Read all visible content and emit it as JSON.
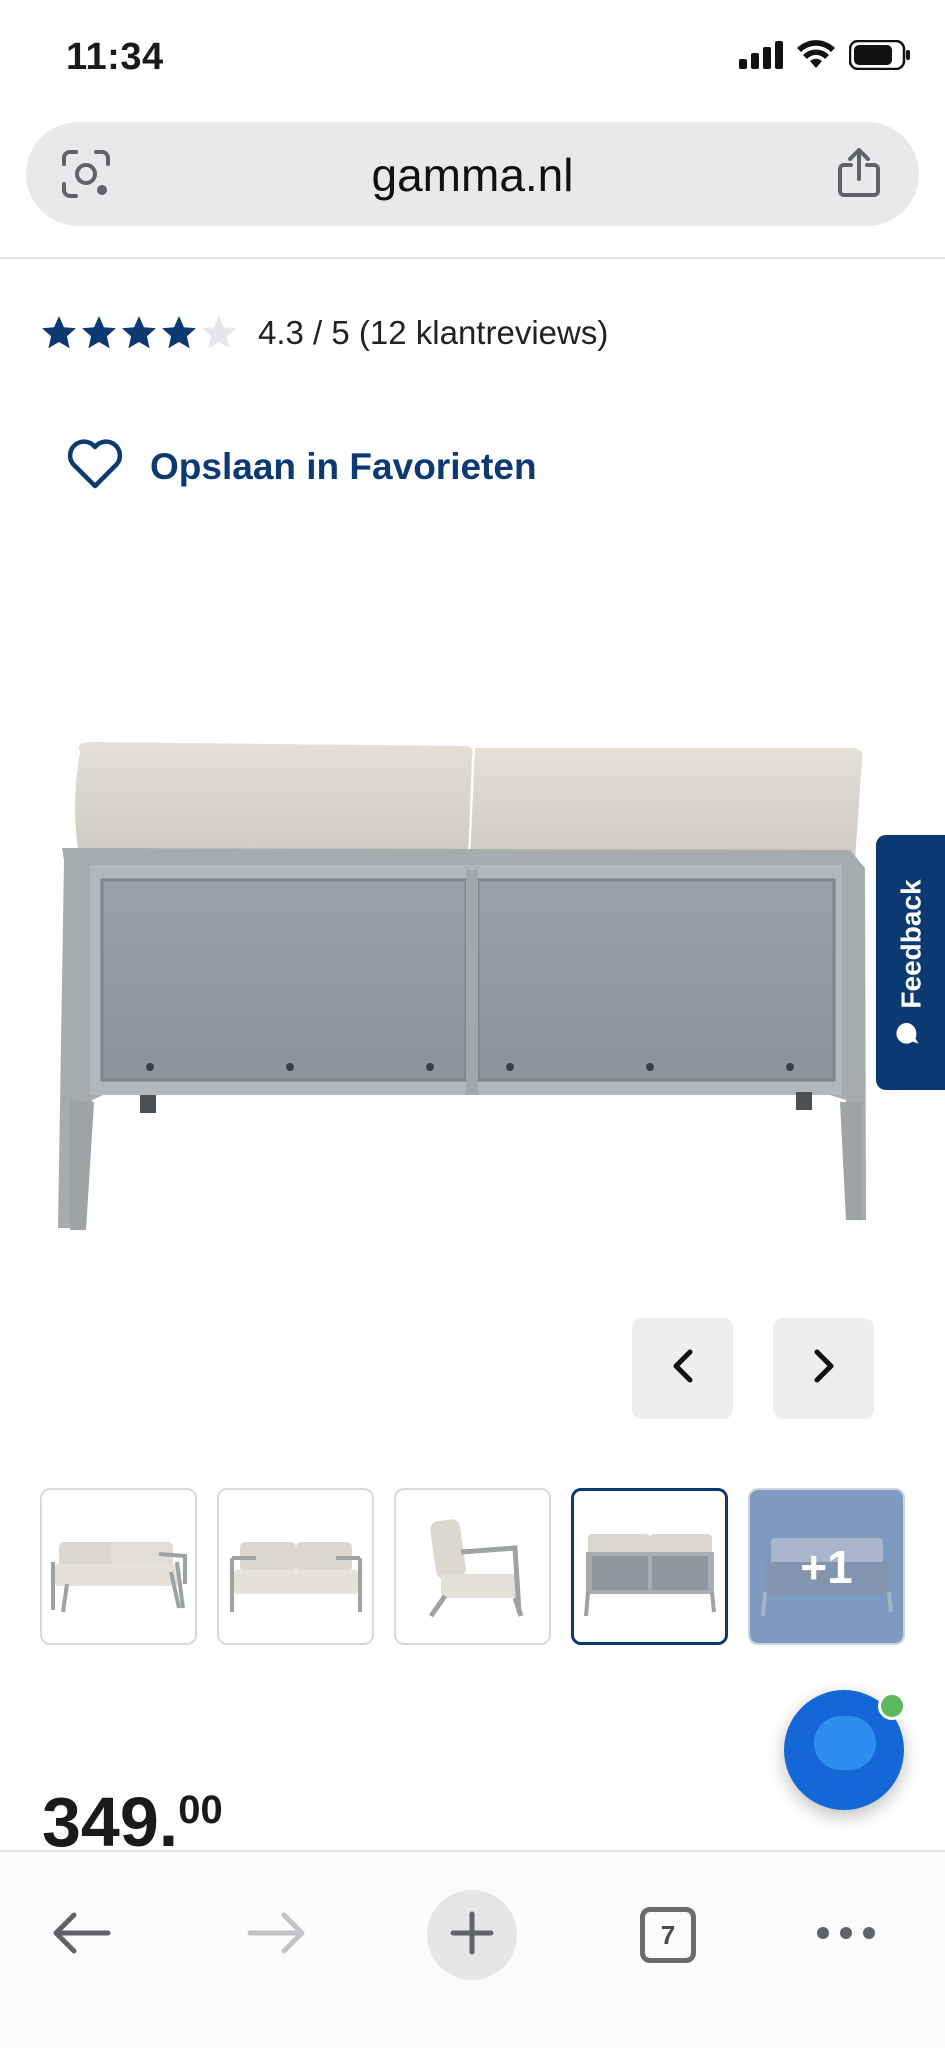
{
  "status_bar": {
    "time": "11:34",
    "icons": [
      "signal-icon",
      "wifi-icon",
      "battery-icon"
    ]
  },
  "browser": {
    "url": "gamma.nl",
    "lens_icon": "lens-icon",
    "share_icon": "share-icon"
  },
  "product": {
    "rating": {
      "stars_filled": 4,
      "stars_total": 5,
      "text": "4.3 / 5 (12 klantreviews)"
    },
    "favorite_label": "Opslaan in Favorieten",
    "image_alt_icon": "product-image",
    "gallery": {
      "thumbnails": [
        {
          "name": "thumb-sofa-front-angle"
        },
        {
          "name": "thumb-sofa-front"
        },
        {
          "name": "thumb-sofa-side"
        },
        {
          "name": "thumb-sofa-back",
          "active": true
        },
        {
          "name": "thumb-more",
          "label": "+1"
        }
      ]
    },
    "price": {
      "whole": "349.",
      "cents": "00"
    }
  },
  "feedback": {
    "label": "Feedback"
  },
  "toolbar": {
    "tabs_count": "7"
  },
  "colors": {
    "brand_blue": "#0b3a73",
    "url_bar": "#e9e9ec",
    "chat_blue": "#1467d6",
    "status_online": "#5cb85c"
  }
}
